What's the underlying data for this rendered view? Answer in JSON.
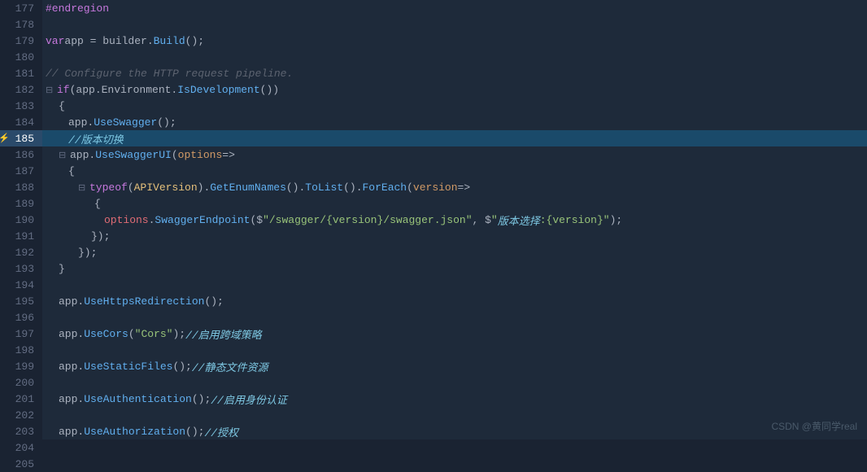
{
  "editor": {
    "background": "#1e2a3a",
    "lineHeight": 20
  },
  "lines": [
    {
      "num": 177,
      "content": "#endregion",
      "type": "endregion",
      "indent": 0,
      "highlighted": false
    },
    {
      "num": 178,
      "content": "",
      "type": "empty",
      "highlighted": false
    },
    {
      "num": 179,
      "content": "var app = builder.Build();",
      "type": "code",
      "highlighted": false
    },
    {
      "num": 180,
      "content": "",
      "type": "empty",
      "highlighted": false
    },
    {
      "num": 181,
      "content": "// Configure the HTTP request pipeline.",
      "type": "comment",
      "highlighted": false
    },
    {
      "num": 182,
      "content": "if (app.Environment.IsDevelopment())",
      "type": "code",
      "highlighted": false,
      "fold": true
    },
    {
      "num": 183,
      "content": "{",
      "type": "code",
      "highlighted": false
    },
    {
      "num": 184,
      "content": "app.UseSwagger();",
      "type": "code",
      "highlighted": false,
      "indent": 2
    },
    {
      "num": 185,
      "content": "//版本切换",
      "type": "comment-cn",
      "highlighted": true,
      "arrow": true,
      "indent": 2
    },
    {
      "num": 186,
      "content": "app.UseSwaggerUI(options =>",
      "type": "code",
      "highlighted": false,
      "fold": true,
      "indent": 2
    },
    {
      "num": 187,
      "content": "{",
      "type": "code",
      "highlighted": false,
      "indent": 3
    },
    {
      "num": 188,
      "content": "typeof(APIVersion).GetEnumNames().ToList().ForEach(version =>",
      "type": "code",
      "highlighted": false,
      "fold": true,
      "indent": 4
    },
    {
      "num": 189,
      "content": "{",
      "type": "code",
      "highlighted": false,
      "indent": 5
    },
    {
      "num": 190,
      "content": "options.SwaggerEndpoint($\"/swagger/{version}/swagger.json\", $\"版本选择:{version}\");",
      "type": "code",
      "highlighted": false,
      "indent": 6
    },
    {
      "num": 191,
      "content": "});",
      "type": "code",
      "highlighted": false,
      "indent": 4
    },
    {
      "num": 192,
      "content": "});",
      "type": "code",
      "highlighted": false,
      "indent": 3
    },
    {
      "num": 193,
      "content": "}",
      "type": "code",
      "highlighted": false,
      "indent": 1
    },
    {
      "num": 194,
      "content": "",
      "type": "empty",
      "highlighted": false
    },
    {
      "num": 195,
      "content": "app.UseHttpsRedirection();",
      "type": "code",
      "highlighted": false,
      "indent": 1
    },
    {
      "num": 196,
      "content": "",
      "type": "empty",
      "highlighted": false
    },
    {
      "num": 197,
      "content": "app.UseCors(\"Cors\");     //启用跨域策略",
      "type": "code",
      "highlighted": false,
      "indent": 1
    },
    {
      "num": 198,
      "content": "",
      "type": "empty",
      "highlighted": false
    },
    {
      "num": 199,
      "content": "app.UseStaticFiles();     //静态文件资源",
      "type": "code",
      "highlighted": false,
      "indent": 1
    },
    {
      "num": 200,
      "content": "",
      "type": "empty",
      "highlighted": false
    },
    {
      "num": 201,
      "content": "app.UseAuthentication();     //启用身份认证",
      "type": "code",
      "highlighted": false,
      "indent": 1
    },
    {
      "num": 202,
      "content": "",
      "type": "empty",
      "highlighted": false
    },
    {
      "num": 203,
      "content": "app.UseAuthorization();     //授权",
      "type": "code",
      "highlighted": false,
      "indent": 1
    },
    {
      "num": 204,
      "content": "",
      "type": "empty",
      "highlighted": false
    },
    {
      "num": 205,
      "content": "",
      "type": "empty",
      "highlighted": false
    }
  ],
  "watermark": "CSDN @黄同学real"
}
